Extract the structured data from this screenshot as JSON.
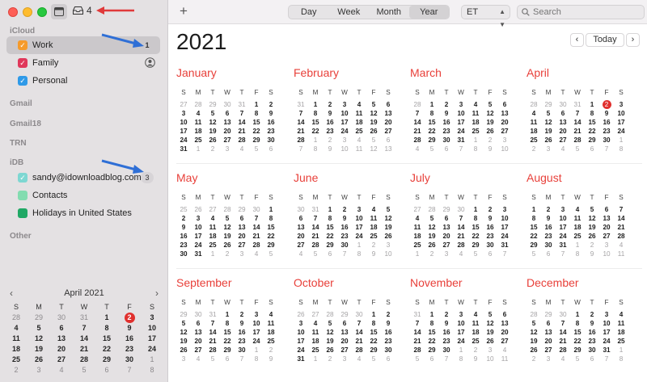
{
  "window": {
    "inbox_count": "4"
  },
  "sidebar": {
    "icloud_header": "iCloud",
    "icloud_items": [
      {
        "label": "Work",
        "color": "#f59b2c",
        "badge": "1"
      },
      {
        "label": "Family",
        "color": "#e0385b"
      },
      {
        "label": "Personal",
        "color": "#2f9ae8"
      }
    ],
    "gmail_header": "Gmail",
    "gmail18_header": "Gmail18",
    "trn_header": "TRN",
    "idb_header": "iDB",
    "idb_items": [
      {
        "label": "sandy@idownloadblog.com",
        "color": "#7ed7d2",
        "badge": "3"
      },
      {
        "label": "Contacts",
        "color": "#83dcb0"
      },
      {
        "label": "Holidays in United States",
        "color": "#20a865"
      }
    ],
    "other_header": "Other",
    "mini_calendar": {
      "title": "April 2021",
      "weekdays": [
        "S",
        "M",
        "T",
        "W",
        "T",
        "F",
        "S"
      ],
      "weeks": [
        [
          "28",
          "29",
          "30",
          "31",
          "1",
          "2",
          "3"
        ],
        [
          "4",
          "5",
          "6",
          "7",
          "8",
          "9",
          "10"
        ],
        [
          "11",
          "12",
          "13",
          "14",
          "15",
          "16",
          "17"
        ],
        [
          "18",
          "19",
          "20",
          "21",
          "22",
          "23",
          "24"
        ],
        [
          "25",
          "26",
          "27",
          "28",
          "29",
          "30",
          "1"
        ],
        [
          "2",
          "3",
          "4",
          "5",
          "6",
          "7",
          "8"
        ]
      ]
    }
  },
  "toolbar": {
    "add_label": "+",
    "views": [
      "Day",
      "Week",
      "Month",
      "Year"
    ],
    "active_view": "Year",
    "timezone": "ET",
    "search_placeholder": "Search"
  },
  "main": {
    "year": "2021",
    "today_label": "Today",
    "accent_color": "#e8403a",
    "weekdays": [
      "S",
      "M",
      "T",
      "W",
      "T",
      "F",
      "S"
    ],
    "months": [
      {
        "name": "January",
        "days": [
          [
            "27",
            "28",
            "29",
            "30",
            "31",
            "1",
            "2"
          ],
          [
            "3",
            "4",
            "5",
            "6",
            "7",
            "8",
            "9"
          ],
          [
            "10",
            "11",
            "12",
            "13",
            "14",
            "15",
            "16"
          ],
          [
            "17",
            "18",
            "19",
            "20",
            "21",
            "22",
            "23"
          ],
          [
            "24",
            "25",
            "26",
            "27",
            "28",
            "29",
            "30"
          ],
          [
            "31",
            "1",
            "2",
            "3",
            "4",
            "5",
            "6"
          ]
        ]
      },
      {
        "name": "February",
        "days": [
          [
            "31",
            "1",
            "2",
            "3",
            "4",
            "5",
            "6"
          ],
          [
            "7",
            "8",
            "9",
            "10",
            "11",
            "12",
            "13"
          ],
          [
            "14",
            "15",
            "16",
            "17",
            "18",
            "19",
            "20"
          ],
          [
            "21",
            "22",
            "23",
            "24",
            "25",
            "26",
            "27"
          ],
          [
            "28",
            "1",
            "2",
            "3",
            "4",
            "5",
            "6"
          ],
          [
            "7",
            "8",
            "9",
            "10",
            "11",
            "12",
            "13"
          ]
        ]
      },
      {
        "name": "March",
        "days": [
          [
            "28",
            "1",
            "2",
            "3",
            "4",
            "5",
            "6"
          ],
          [
            "7",
            "8",
            "9",
            "10",
            "11",
            "12",
            "13"
          ],
          [
            "14",
            "15",
            "16",
            "17",
            "18",
            "19",
            "20"
          ],
          [
            "21",
            "22",
            "23",
            "24",
            "25",
            "26",
            "27"
          ],
          [
            "28",
            "29",
            "30",
            "31",
            "1",
            "2",
            "3"
          ],
          [
            "4",
            "5",
            "6",
            "7",
            "8",
            "9",
            "10"
          ]
        ]
      },
      {
        "name": "April",
        "days": [
          [
            "28",
            "29",
            "30",
            "31",
            "1",
            "2",
            "3"
          ],
          [
            "4",
            "5",
            "6",
            "7",
            "8",
            "9",
            "10"
          ],
          [
            "11",
            "12",
            "13",
            "14",
            "15",
            "16",
            "17"
          ],
          [
            "18",
            "19",
            "20",
            "21",
            "22",
            "23",
            "24"
          ],
          [
            "25",
            "26",
            "27",
            "28",
            "29",
            "30",
            "1"
          ],
          [
            "2",
            "3",
            "4",
            "5",
            "6",
            "7",
            "8"
          ]
        ]
      },
      {
        "name": "May",
        "days": [
          [
            "25",
            "26",
            "27",
            "28",
            "29",
            "30",
            "1"
          ],
          [
            "2",
            "3",
            "4",
            "5",
            "6",
            "7",
            "8"
          ],
          [
            "9",
            "10",
            "11",
            "12",
            "13",
            "14",
            "15"
          ],
          [
            "16",
            "17",
            "18",
            "19",
            "20",
            "21",
            "22"
          ],
          [
            "23",
            "24",
            "25",
            "26",
            "27",
            "28",
            "29"
          ],
          [
            "30",
            "31",
            "1",
            "2",
            "3",
            "4",
            "5"
          ]
        ]
      },
      {
        "name": "June",
        "days": [
          [
            "30",
            "31",
            "1",
            "2",
            "3",
            "4",
            "5"
          ],
          [
            "6",
            "7",
            "8",
            "9",
            "10",
            "11",
            "12"
          ],
          [
            "13",
            "14",
            "15",
            "16",
            "17",
            "18",
            "19"
          ],
          [
            "20",
            "21",
            "22",
            "23",
            "24",
            "25",
            "26"
          ],
          [
            "27",
            "28",
            "29",
            "30",
            "1",
            "2",
            "3"
          ],
          [
            "4",
            "5",
            "6",
            "7",
            "8",
            "9",
            "10"
          ]
        ]
      },
      {
        "name": "July",
        "days": [
          [
            "27",
            "28",
            "29",
            "30",
            "1",
            "2",
            "3"
          ],
          [
            "4",
            "5",
            "6",
            "7",
            "8",
            "9",
            "10"
          ],
          [
            "11",
            "12",
            "13",
            "14",
            "15",
            "16",
            "17"
          ],
          [
            "18",
            "19",
            "20",
            "21",
            "22",
            "23",
            "24"
          ],
          [
            "25",
            "26",
            "27",
            "28",
            "29",
            "30",
            "31"
          ],
          [
            "1",
            "2",
            "3",
            "4",
            "5",
            "6",
            "7"
          ]
        ]
      },
      {
        "name": "August",
        "days": [
          [
            "1",
            "2",
            "3",
            "4",
            "5",
            "6",
            "7"
          ],
          [
            "8",
            "9",
            "10",
            "11",
            "12",
            "13",
            "14"
          ],
          [
            "15",
            "16",
            "17",
            "18",
            "19",
            "20",
            "21"
          ],
          [
            "22",
            "23",
            "24",
            "25",
            "26",
            "27",
            "28"
          ],
          [
            "29",
            "30",
            "31",
            "1",
            "2",
            "3",
            "4"
          ],
          [
            "5",
            "6",
            "7",
            "8",
            "9",
            "10",
            "11"
          ]
        ]
      },
      {
        "name": "September",
        "days": [
          [
            "29",
            "30",
            "31",
            "1",
            "2",
            "3",
            "4"
          ],
          [
            "5",
            "6",
            "7",
            "8",
            "9",
            "10",
            "11"
          ],
          [
            "12",
            "13",
            "14",
            "15",
            "16",
            "17",
            "18"
          ],
          [
            "19",
            "20",
            "21",
            "22",
            "23",
            "24",
            "25"
          ],
          [
            "26",
            "27",
            "28",
            "29",
            "30",
            "1",
            "2"
          ],
          [
            "3",
            "4",
            "5",
            "6",
            "7",
            "8",
            "9"
          ]
        ]
      },
      {
        "name": "October",
        "days": [
          [
            "26",
            "27",
            "28",
            "29",
            "30",
            "1",
            "2"
          ],
          [
            "3",
            "4",
            "5",
            "6",
            "7",
            "8",
            "9"
          ],
          [
            "10",
            "11",
            "12",
            "13",
            "14",
            "15",
            "16"
          ],
          [
            "17",
            "18",
            "19",
            "20",
            "21",
            "22",
            "23"
          ],
          [
            "24",
            "25",
            "26",
            "27",
            "28",
            "29",
            "30"
          ],
          [
            "31",
            "1",
            "2",
            "3",
            "4",
            "5",
            "6"
          ]
        ]
      },
      {
        "name": "November",
        "days": [
          [
            "31",
            "1",
            "2",
            "3",
            "4",
            "5",
            "6"
          ],
          [
            "7",
            "8",
            "9",
            "10",
            "11",
            "12",
            "13"
          ],
          [
            "14",
            "15",
            "16",
            "17",
            "18",
            "19",
            "20"
          ],
          [
            "21",
            "22",
            "23",
            "24",
            "25",
            "26",
            "27"
          ],
          [
            "28",
            "29",
            "30",
            "1",
            "2",
            "3",
            "4"
          ],
          [
            "5",
            "6",
            "7",
            "8",
            "9",
            "10",
            "11"
          ]
        ]
      },
      {
        "name": "December",
        "days": [
          [
            "28",
            "29",
            "30",
            "1",
            "2",
            "3",
            "4"
          ],
          [
            "5",
            "6",
            "7",
            "8",
            "9",
            "10",
            "11"
          ],
          [
            "12",
            "13",
            "14",
            "15",
            "16",
            "17",
            "18"
          ],
          [
            "19",
            "20",
            "21",
            "22",
            "23",
            "24",
            "25"
          ],
          [
            "26",
            "27",
            "28",
            "29",
            "30",
            "31",
            "1"
          ],
          [
            "2",
            "3",
            "4",
            "5",
            "6",
            "7",
            "8"
          ]
        ]
      }
    ],
    "today": {
      "month": "April",
      "day": "2"
    }
  }
}
